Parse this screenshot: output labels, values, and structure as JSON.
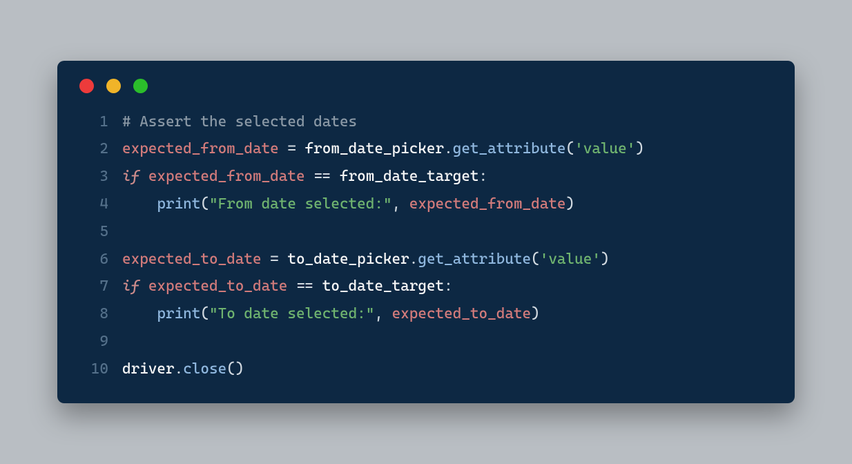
{
  "colors": {
    "bg_page": "#b9bec3",
    "bg_window": "#0d2843",
    "traffic_red": "#ed3b3b",
    "traffic_yellow": "#f0b429",
    "traffic_green": "#2bbd2b",
    "line_number": "#54708a",
    "comment": "#8a98a5",
    "variable": "#d27b7b",
    "function": "#f7f7f7",
    "method": "#8fb7de",
    "string": "#6fb36f",
    "keyword": "#cc8b8b"
  },
  "code": {
    "language": "python",
    "lines": [
      {
        "n": "1",
        "tokens": [
          {
            "cls": "cm",
            "t": "# Assert the selected dates"
          }
        ]
      },
      {
        "n": "2",
        "tokens": [
          {
            "cls": "var",
            "t": "expected_from_date"
          },
          {
            "cls": "op",
            "t": " = "
          },
          {
            "cls": "fn",
            "t": "from_date_picker"
          },
          {
            "cls": "op",
            "t": "."
          },
          {
            "cls": "meth",
            "t": "get_attribute"
          },
          {
            "cls": "op",
            "t": "("
          },
          {
            "cls": "str",
            "t": "'value'"
          },
          {
            "cls": "op",
            "t": ")"
          }
        ]
      },
      {
        "n": "3",
        "tokens": [
          {
            "cls": "kw",
            "t": "if"
          },
          {
            "cls": "op",
            "t": " "
          },
          {
            "cls": "var",
            "t": "expected_from_date"
          },
          {
            "cls": "op",
            "t": " == "
          },
          {
            "cls": "fn",
            "t": "from_date_target"
          },
          {
            "cls": "op",
            "t": ":"
          }
        ]
      },
      {
        "n": "4",
        "tokens": [
          {
            "cls": "op",
            "t": "    "
          },
          {
            "cls": "meth",
            "t": "print"
          },
          {
            "cls": "op",
            "t": "("
          },
          {
            "cls": "str",
            "t": "\"From date selected:\""
          },
          {
            "cls": "op",
            "t": ", "
          },
          {
            "cls": "var",
            "t": "expected_from_date"
          },
          {
            "cls": "op",
            "t": ")"
          }
        ]
      },
      {
        "n": "5",
        "tokens": [
          {
            "cls": "op",
            "t": ""
          }
        ]
      },
      {
        "n": "6",
        "tokens": [
          {
            "cls": "var",
            "t": "expected_to_date"
          },
          {
            "cls": "op",
            "t": " = "
          },
          {
            "cls": "fn",
            "t": "to_date_picker"
          },
          {
            "cls": "op",
            "t": "."
          },
          {
            "cls": "meth",
            "t": "get_attribute"
          },
          {
            "cls": "op",
            "t": "("
          },
          {
            "cls": "str",
            "t": "'value'"
          },
          {
            "cls": "op",
            "t": ")"
          }
        ]
      },
      {
        "n": "7",
        "tokens": [
          {
            "cls": "kw",
            "t": "if"
          },
          {
            "cls": "op",
            "t": " "
          },
          {
            "cls": "var",
            "t": "expected_to_date"
          },
          {
            "cls": "op",
            "t": " == "
          },
          {
            "cls": "fn",
            "t": "to_date_target"
          },
          {
            "cls": "op",
            "t": ":"
          }
        ]
      },
      {
        "n": "8",
        "tokens": [
          {
            "cls": "op",
            "t": "    "
          },
          {
            "cls": "meth",
            "t": "print"
          },
          {
            "cls": "op",
            "t": "("
          },
          {
            "cls": "str",
            "t": "\"To date selected:\""
          },
          {
            "cls": "op",
            "t": ", "
          },
          {
            "cls": "var",
            "t": "expected_to_date"
          },
          {
            "cls": "op",
            "t": ")"
          }
        ]
      },
      {
        "n": "9",
        "tokens": [
          {
            "cls": "op",
            "t": ""
          }
        ]
      },
      {
        "n": "10",
        "tokens": [
          {
            "cls": "fn",
            "t": "driver"
          },
          {
            "cls": "op",
            "t": "."
          },
          {
            "cls": "meth",
            "t": "close"
          },
          {
            "cls": "op",
            "t": "()"
          }
        ]
      }
    ]
  }
}
